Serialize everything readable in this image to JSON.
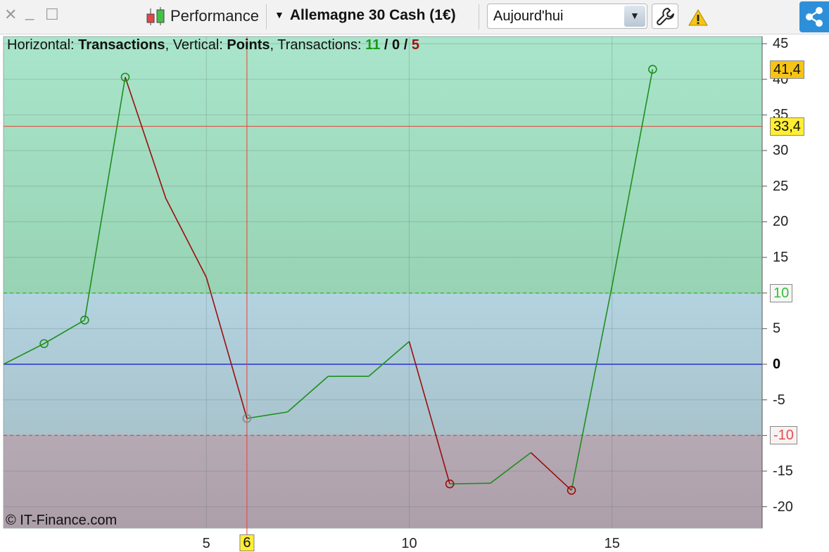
{
  "toolbar": {
    "close_glyph": "✕",
    "minimize_glyph": "_",
    "maximize_glyph": "☐",
    "title": "Performance",
    "instrument": "Allemagne 30 Cash (1€)",
    "period": "Aujourd'hui"
  },
  "header": {
    "horizontal_label": "Horizontal:",
    "horizontal_value": "Transactions",
    "vertical_label": "Vertical:",
    "vertical_value": "Points",
    "transactions_label": "Transactions:",
    "tx_winning": "11",
    "tx_neutral": "0",
    "tx_losing": "5"
  },
  "copyright": "© IT-Finance.com",
  "markers": {
    "last_value_label": "41,4",
    "cursor_value_label": "33,4",
    "cursor_value": 33.4,
    "cursor_x": 6,
    "cursor_x_label": "6",
    "upper_threshold": 10,
    "upper_threshold_label": "10",
    "lower_threshold": -10,
    "lower_threshold_label": "-10",
    "zero_label": "0"
  },
  "colors": {
    "gain": "#1e8f1e",
    "loss": "#9a0d0d",
    "neutral_point": "#888888",
    "zero_line": "#2a33d0",
    "cursor": "#e8413a",
    "upper_threshold": "#3dbb3d",
    "lower_threshold": "#e05050",
    "gain_zone_top": "#a9e5cb",
    "gain_zone_bottom": "#98d3b4",
    "mid_zone_top": "#b3d3e0",
    "mid_zone_bottom": "#a8c3cc",
    "loss_zone_top": "#b5a9b4",
    "loss_zone_bottom": "#ad9fa9",
    "last_value_box": "#f6c417",
    "cursor_value_box": "#ffee33"
  },
  "chart_data": {
    "type": "line",
    "x": [
      0,
      1,
      2,
      3,
      4,
      5,
      6,
      7,
      8,
      9,
      10,
      11,
      12,
      13,
      14,
      15,
      16
    ],
    "values": [
      0,
      2.9,
      6.2,
      40.3,
      23.3,
      12.2,
      -7.6,
      -6.7,
      -1.7,
      -1.7,
      3.2,
      -16.8,
      -16.7,
      -12.4,
      -17.7,
      11.0,
      41.4
    ],
    "markers_at": [
      1,
      2,
      3,
      6,
      11,
      14,
      16
    ],
    "xlim": [
      0,
      18.7
    ],
    "ylim": [
      -23,
      46
    ],
    "x_ticks": [
      5,
      10,
      15
    ],
    "x_tick_labels": [
      "5",
      "10",
      "15"
    ],
    "y_ticks": [
      45,
      40,
      35,
      30,
      25,
      20,
      15,
      10,
      5,
      0,
      -5,
      -10,
      -15,
      -20
    ],
    "y_tick_labels": [
      "45",
      "40",
      "35",
      "30",
      "25",
      "20",
      "15",
      "10",
      "5",
      "0",
      "-5",
      "-10",
      "-15",
      "-20"
    ],
    "grid": true
  }
}
